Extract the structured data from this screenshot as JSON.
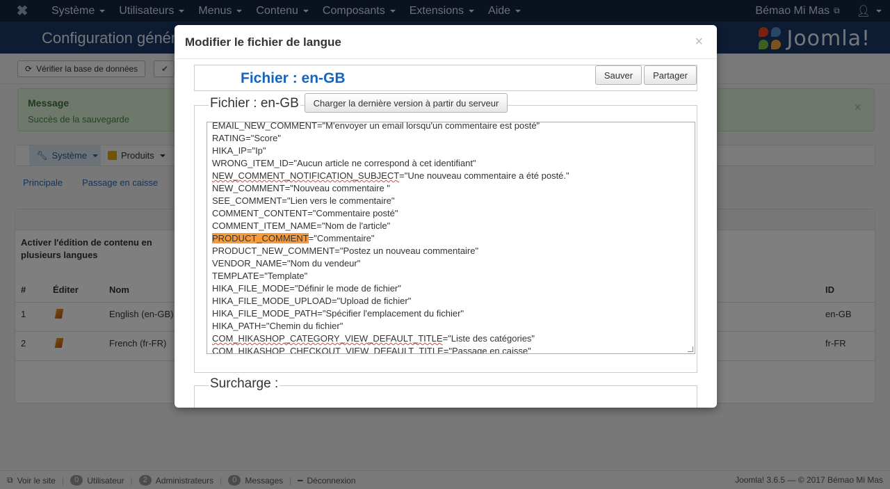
{
  "navbar": {
    "menus": [
      "Système",
      "Utilisateurs",
      "Menus",
      "Contenu",
      "Composants",
      "Extensions",
      "Aide"
    ],
    "site_link": "Bémao Mi Mas",
    "user_icon": "user-icon"
  },
  "subheader": {
    "title": "Configuration générale",
    "brand": "Joomla!"
  },
  "toolbar": {
    "check_db": "Vérifier la base de données",
    "check_icon": "check-icon"
  },
  "message": {
    "title": "Message",
    "text": "Succès de la sauvegarde",
    "close": "×"
  },
  "tabs": {
    "system": "Système",
    "products": "Produits",
    "subnav": [
      "Principale",
      "Passage en caisse"
    ]
  },
  "panel": {
    "note": "Activer l'édition de contenu en plusieurs langues",
    "columns": [
      "#",
      "Éditer",
      "Nom",
      "ID"
    ],
    "rows": [
      {
        "num": "1",
        "name": "English (en-GB)",
        "id": "en-GB"
      },
      {
        "num": "2",
        "name": "French (fr-FR)",
        "id": "fr-FR"
      }
    ]
  },
  "statusbar": {
    "view_site": "Voir le site",
    "users_count": "0",
    "users_label": "Utilisateur",
    "admins_count": "2",
    "admins_label": "Administrateurs",
    "messages_count": "0",
    "messages_label": "Messages",
    "logout": "Déconnexion",
    "right": "Joomla! 3.6.5 — © 2017 Bémao Mi Mas"
  },
  "modal": {
    "title": "Modifier le fichier de langue",
    "close": "×",
    "file_title": "Fichier : en-GB",
    "save": "Sauver",
    "share": "Partager",
    "fieldset_legend": "Fichier : en-GB",
    "load_latest": "Charger la dernière version à partir du serveur",
    "override_legend": "Surcharge :",
    "lines": [
      {
        "key": "EMAIL_NEW_COMMENT",
        "val": "=\"M'envoyer un email lorsqu'un commentaire est posté\""
      },
      {
        "key": "RATING",
        "val": "=\"Score\""
      },
      {
        "key": "HIKA_IP",
        "val": "=\"Ip\""
      },
      {
        "key": "WRONG_ITEM_ID",
        "val": "=\"Aucun article ne correspond à cet identifiant\""
      },
      {
        "key": "NEW_COMMENT_NOTIFICATION_SUBJECT",
        "val": "=\"Une nouveau commentaire a été posté.\""
      },
      {
        "key": "NEW_COMMENT",
        "val": "=\"Nouveau commentaire \""
      },
      {
        "key": "SEE_COMMENT",
        "val": "=\"Lien vers le commentaire\""
      },
      {
        "key": "COMMENT_CONTENT",
        "val": "=\"Commentaire posté\""
      },
      {
        "key": "COMMENT_ITEM_NAME",
        "val": "=\"Nom de l'article\""
      },
      {
        "key": "PRODUCT_COMMENT",
        "val": "=\"Commentaire\""
      },
      {
        "key": "PRODUCT_NEW_COMMENT",
        "val": "=\"Postez un nouveau commentaire\""
      },
      {
        "key": "VENDOR_NAME",
        "val": "=\"Nom du vendeur\""
      },
      {
        "key": "TEMPLATE",
        "val": "=\"Template\""
      },
      {
        "key": "HIKA_FILE_MODE",
        "val": "=\"Définir le mode de fichier\""
      },
      {
        "key": "HIKA_FILE_MODE_UPLOAD",
        "val": "=\"Upload de fichier\""
      },
      {
        "key": "HIKA_FILE_MODE_PATH",
        "val": "=\"Spécifier l'emplacement du fichier\""
      },
      {
        "key": "HIKA_PATH",
        "val": "=\"Chemin du fichier\""
      },
      {
        "key": "COM_HIKASHOP_CATEGORY_VIEW_DEFAULT_TITLE",
        "val": "=\"Liste des catégories\""
      },
      {
        "key": "COM_HIKASHOP_CHECKOUT_VIEW_DEFAULT_TITLE",
        "val": "=\"Passage en caisse\""
      }
    ]
  }
}
